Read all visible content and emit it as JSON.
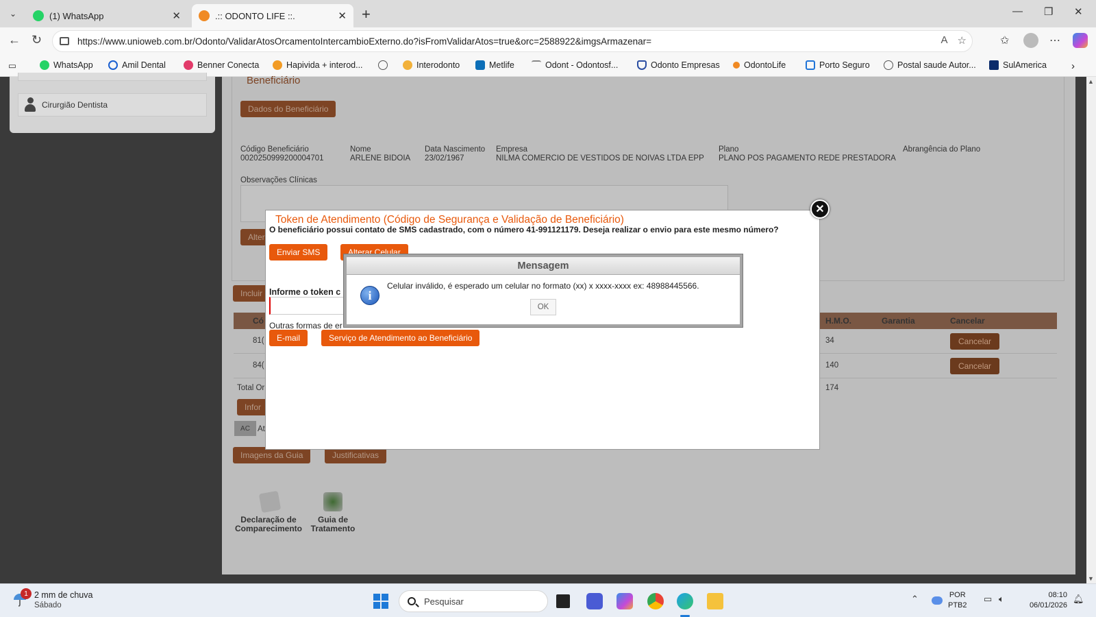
{
  "browser": {
    "tabs": [
      {
        "label": "(1) WhatsApp",
        "color": "#25d366"
      },
      {
        "label": ".:: ODONTO LIFE ::.",
        "color": "#f08a24"
      }
    ],
    "url": "https://www.unioweb.com.br/Odonto/ValidarAtosOrcamentoIntercambioExterno.do?isFromValidarAtos=true&orc=2588922&imgsArmazenar=",
    "bookmarks": [
      {
        "label": "WhatsApp",
        "icon": "whatsapp-icon",
        "color": "#25d366"
      },
      {
        "label": "Amil Dental",
        "icon": "amil-icon",
        "color": "#1a5fd0"
      },
      {
        "label": "Benner Conecta",
        "icon": "benner-icon",
        "color": "#e23b6a"
      },
      {
        "label": "Hapivida + interod...",
        "icon": "hapvida-icon",
        "color": "#f29b25"
      },
      {
        "label": "",
        "icon": "globe-icon",
        "color": "#555555"
      },
      {
        "label": "Interodonto",
        "icon": "interodonto-icon",
        "color": "#f2b13a"
      },
      {
        "label": "Metlife",
        "icon": "metlife-icon",
        "color": "#0d6fb8"
      },
      {
        "label": "Odont - Odontosf...",
        "icon": "odontosf-icon",
        "color": "#888888"
      },
      {
        "label": "Odonto Empresas",
        "icon": "shield-icon",
        "color": "#2b4ea2"
      },
      {
        "label": "OdontoLife",
        "icon": "odontolife-icon",
        "color": "#f08a24"
      },
      {
        "label": "Porto Seguro",
        "icon": "porto-icon",
        "color": "#1f74d8"
      },
      {
        "label": "Postal saude Autor...",
        "icon": "globe-icon",
        "color": "#555555"
      },
      {
        "label": "SulAmerica",
        "icon": "sulamerica-icon",
        "color": "#0b2b6b"
      }
    ]
  },
  "sidebar": {
    "item_label": "Cirurgião Dentista"
  },
  "page": {
    "section_title": "Beneficiário",
    "dados_button": "Dados do Beneficiário",
    "fields": [
      {
        "label": "Código Beneficiário",
        "value": "0020250999200004701"
      },
      {
        "label": "Nome",
        "value": "ARLENE BIDOIA"
      },
      {
        "label": "Data Nascimento",
        "value": "23/02/1967"
      },
      {
        "label": "Empresa",
        "value": "NILMA COMERCIO DE VESTIDOS DE NOIVAS LTDA EPP"
      },
      {
        "label": "Plano",
        "value": "PLANO POS PAGAMENTO REDE PRESTADORA"
      },
      {
        "label": "Abrangência do Plano",
        "value": ""
      }
    ],
    "obs_label": "Observações Clínicas",
    "alterar_btn_partial": "Alter",
    "incluir_btn_partial": "Incluir",
    "table_headers": {
      "cod_partial": "Có",
      "hmo": "H.M.O.",
      "garantia": "Garantia",
      "cancelar": "Cancelar"
    },
    "rows": [
      {
        "code_partial": "81(",
        "hmo": "34",
        "cancel_label": "Cancelar"
      },
      {
        "code_partial": "84(",
        "hmo": "140",
        "cancel_label": "Cancelar"
      }
    ],
    "total_label_partial": "Total Or",
    "total_hmo": "174",
    "informar_btn_partial": "Infor",
    "ac_chip": "AC",
    "ac_text_partial": "At",
    "imagens_btn": "Imagens da Guia",
    "justificativas_btn": "Justificativas",
    "docs": [
      {
        "label1": "Declaração de",
        "label2": "Comparecimento"
      },
      {
        "label1": "Guia de",
        "label2": "Tratamento"
      }
    ]
  },
  "token_modal": {
    "title": "Token de Atendimento (Código de Segurança e Validação de Beneficiário)",
    "text": "O beneficiário possui contato de SMS cadastrado, com o número 41-991121179. Deseja realizar o envio para este mesmo número?",
    "enviar_sms": "Enviar SMS",
    "alterar_celular": "Alterar Celular",
    "token_label_partial": "Informe o token c",
    "outras_formas_partial": "Outras formas de er",
    "email_btn": "E-mail",
    "servico_btn": "Serviço de Atendimento ao Beneficiário"
  },
  "message": {
    "title": "Mensagem",
    "text": "Celular inválido, é esperado um celular no formato (xx) x xxxx-xxxx ex: 48988445566.",
    "ok": "OK"
  },
  "taskbar": {
    "weather_badge": "1",
    "weather_text": "2 mm de chuva",
    "weather_day": "Sábado",
    "search_placeholder": "Pesquisar",
    "lang1": "POR",
    "lang2": "PTB2",
    "time": "08:10",
    "date": "06/01/2026"
  },
  "colors": {
    "accent_orange": "#e8590c",
    "dim_orange": "#7d4424",
    "overlay": "#3a3a3a"
  }
}
